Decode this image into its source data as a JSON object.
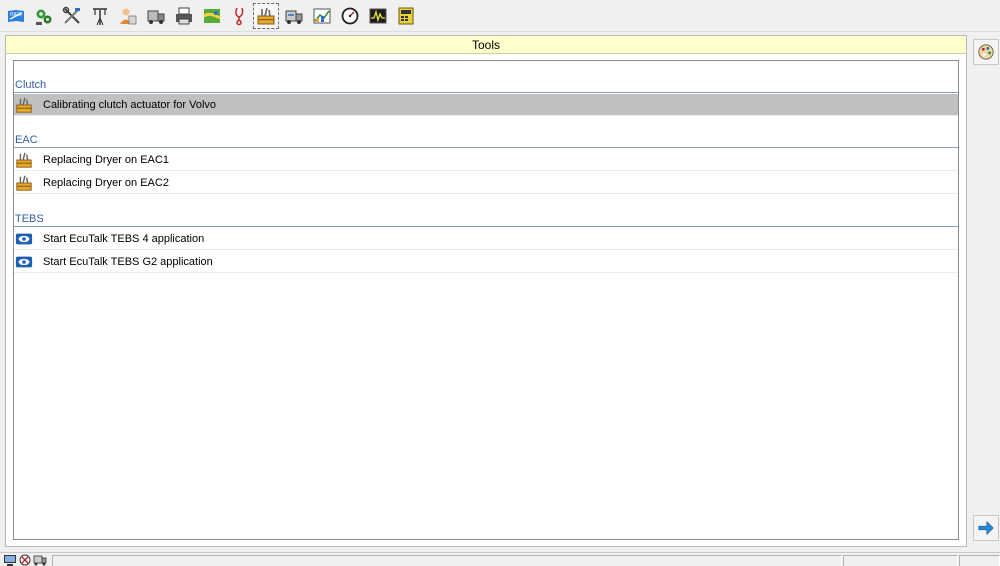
{
  "toolbar": {
    "buttons": [
      {
        "icon": "info-book-icon"
      },
      {
        "icon": "gears-icon"
      },
      {
        "icon": "tools-icon"
      },
      {
        "icon": "antenna-icon"
      },
      {
        "icon": "person-icon"
      },
      {
        "icon": "trailer-diagnostics-icon"
      },
      {
        "icon": "printer-icon"
      },
      {
        "icon": "map-icon"
      },
      {
        "icon": "stethoscope-icon"
      },
      {
        "icon": "toolbox-icon",
        "active": true
      },
      {
        "icon": "trailer-tools-icon"
      },
      {
        "icon": "chart-icon"
      },
      {
        "icon": "gauge-icon"
      },
      {
        "icon": "signal-monitor-icon"
      },
      {
        "icon": "calculator-icon"
      }
    ]
  },
  "panel": {
    "title": "Tools"
  },
  "groups": [
    {
      "header": "Clutch",
      "items": [
        {
          "label": "Calibrating clutch actuator for Volvo",
          "icon": "toolbox-icon",
          "selected": true
        }
      ]
    },
    {
      "header": "EAC",
      "items": [
        {
          "label": "Replacing Dryer on EAC1",
          "icon": "toolbox-icon"
        },
        {
          "label": "Replacing Dryer on EAC2",
          "icon": "toolbox-icon"
        }
      ]
    },
    {
      "header": "TEBS",
      "items": [
        {
          "label": "Start EcuTalk TEBS 4 application",
          "icon": "ecutalk-icon"
        },
        {
          "label": "Start EcuTalk TEBS G2 application",
          "icon": "ecutalk-icon"
        }
      ]
    }
  ],
  "side_bar": {
    "top_button_icon": "palette-icon",
    "bottom_button_icon": "arrow-right-icon"
  },
  "status_bar": {
    "icons": [
      "computer-icon",
      "disconnected-icon",
      "vehicle-icon"
    ]
  },
  "colors": {
    "panel_title_bg": "#ffffcc",
    "group_header_text": "#2e5f9e",
    "selected_row_bg": "#c0c0c0"
  }
}
